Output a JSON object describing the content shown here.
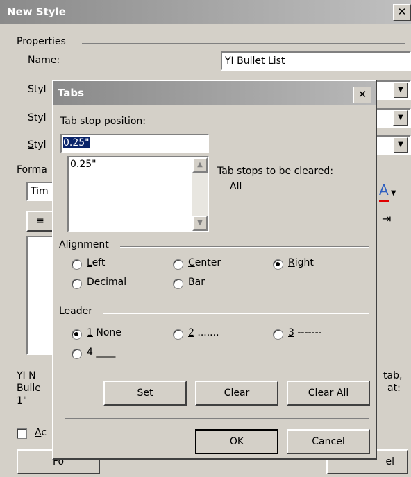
{
  "outer": {
    "title": "New Style",
    "close": "✕",
    "properties_label": "Properties",
    "name_label": "Name:",
    "name_value": "YI Bullet List",
    "style_label_1": "Styl",
    "style_label_2": "Styl",
    "style_label_3": "Styl",
    "format_label": "Forma",
    "font_value": "Tim",
    "desc_line1": "YI N",
    "desc_line2": "Bulle",
    "desc_line3": "1\"",
    "desc_right1": "tab,",
    "desc_right2": "at:",
    "add_label": "Ac",
    "format_btn": "Fo",
    "cancel_btn_partial": "el"
  },
  "tabs_dialog": {
    "title": "Tabs",
    "close": "✕",
    "tab_stop_label": "Tab stop position:",
    "tab_stop_value": "0.25\"",
    "list_items": [
      "0.25\""
    ],
    "to_clear_label": "Tab stops to be cleared:",
    "to_clear_value": "All",
    "alignment_label": "Alignment",
    "alignment": {
      "left": "Left",
      "center": "Center",
      "right": "Right",
      "decimal": "Decimal",
      "bar": "Bar",
      "selected": "right"
    },
    "leader_label": "Leader",
    "leader": {
      "opt1": "1 None",
      "opt2": "2 .......",
      "opt3": "3 -------",
      "opt4": "4 ____",
      "selected": "opt1"
    },
    "buttons": {
      "set": "Set",
      "clear": "Clear",
      "clear_all": "Clear All",
      "ok": "OK",
      "cancel": "Cancel"
    }
  },
  "colors": {
    "dialog_bg": "#d4d0c8",
    "selection": "#0a246a"
  }
}
